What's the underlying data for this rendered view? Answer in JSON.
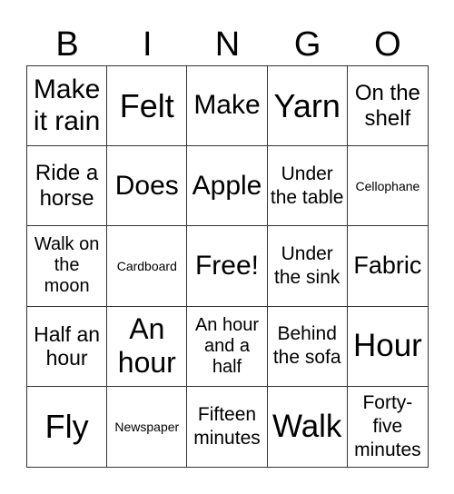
{
  "header": [
    "B",
    "I",
    "N",
    "G",
    "O"
  ],
  "cells": [
    "Make it rain",
    "Felt",
    "Make",
    "Yarn",
    "On the shelf",
    "Ride a horse",
    "Does",
    "Apple",
    "Under the table",
    "Cellophane",
    "Walk on the moon",
    "Cardboard",
    "Free!",
    "Under the sink",
    "Fabric",
    "Half an hour",
    "An hour",
    "An hour and a half",
    "Behind the sofa",
    "Hour",
    "Fly",
    "Newspaper",
    "Fifteen minutes",
    "Walk",
    "Forty-five minutes"
  ]
}
